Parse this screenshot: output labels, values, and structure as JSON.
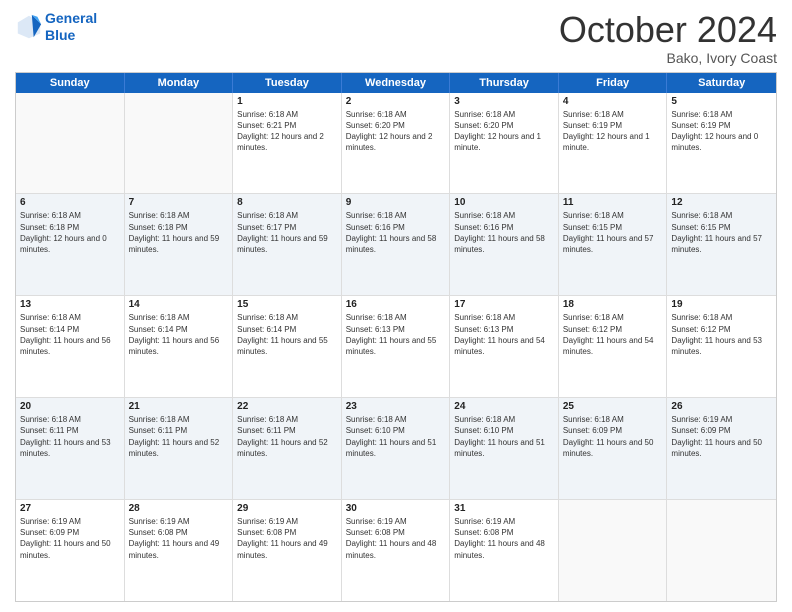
{
  "header": {
    "logo_line1": "General",
    "logo_line2": "Blue",
    "month": "October 2024",
    "location": "Bako, Ivory Coast"
  },
  "days_of_week": [
    "Sunday",
    "Monday",
    "Tuesday",
    "Wednesday",
    "Thursday",
    "Friday",
    "Saturday"
  ],
  "weeks": [
    [
      {
        "day": "",
        "sunrise": "",
        "sunset": "",
        "daylight": ""
      },
      {
        "day": "",
        "sunrise": "",
        "sunset": "",
        "daylight": ""
      },
      {
        "day": "1",
        "sunrise": "Sunrise: 6:18 AM",
        "sunset": "Sunset: 6:21 PM",
        "daylight": "Daylight: 12 hours and 2 minutes."
      },
      {
        "day": "2",
        "sunrise": "Sunrise: 6:18 AM",
        "sunset": "Sunset: 6:20 PM",
        "daylight": "Daylight: 12 hours and 2 minutes."
      },
      {
        "day": "3",
        "sunrise": "Sunrise: 6:18 AM",
        "sunset": "Sunset: 6:20 PM",
        "daylight": "Daylight: 12 hours and 1 minute."
      },
      {
        "day": "4",
        "sunrise": "Sunrise: 6:18 AM",
        "sunset": "Sunset: 6:19 PM",
        "daylight": "Daylight: 12 hours and 1 minute."
      },
      {
        "day": "5",
        "sunrise": "Sunrise: 6:18 AM",
        "sunset": "Sunset: 6:19 PM",
        "daylight": "Daylight: 12 hours and 0 minutes."
      }
    ],
    [
      {
        "day": "6",
        "sunrise": "Sunrise: 6:18 AM",
        "sunset": "Sunset: 6:18 PM",
        "daylight": "Daylight: 12 hours and 0 minutes."
      },
      {
        "day": "7",
        "sunrise": "Sunrise: 6:18 AM",
        "sunset": "Sunset: 6:18 PM",
        "daylight": "Daylight: 11 hours and 59 minutes."
      },
      {
        "day": "8",
        "sunrise": "Sunrise: 6:18 AM",
        "sunset": "Sunset: 6:17 PM",
        "daylight": "Daylight: 11 hours and 59 minutes."
      },
      {
        "day": "9",
        "sunrise": "Sunrise: 6:18 AM",
        "sunset": "Sunset: 6:16 PM",
        "daylight": "Daylight: 11 hours and 58 minutes."
      },
      {
        "day": "10",
        "sunrise": "Sunrise: 6:18 AM",
        "sunset": "Sunset: 6:16 PM",
        "daylight": "Daylight: 11 hours and 58 minutes."
      },
      {
        "day": "11",
        "sunrise": "Sunrise: 6:18 AM",
        "sunset": "Sunset: 6:15 PM",
        "daylight": "Daylight: 11 hours and 57 minutes."
      },
      {
        "day": "12",
        "sunrise": "Sunrise: 6:18 AM",
        "sunset": "Sunset: 6:15 PM",
        "daylight": "Daylight: 11 hours and 57 minutes."
      }
    ],
    [
      {
        "day": "13",
        "sunrise": "Sunrise: 6:18 AM",
        "sunset": "Sunset: 6:14 PM",
        "daylight": "Daylight: 11 hours and 56 minutes."
      },
      {
        "day": "14",
        "sunrise": "Sunrise: 6:18 AM",
        "sunset": "Sunset: 6:14 PM",
        "daylight": "Daylight: 11 hours and 56 minutes."
      },
      {
        "day": "15",
        "sunrise": "Sunrise: 6:18 AM",
        "sunset": "Sunset: 6:14 PM",
        "daylight": "Daylight: 11 hours and 55 minutes."
      },
      {
        "day": "16",
        "sunrise": "Sunrise: 6:18 AM",
        "sunset": "Sunset: 6:13 PM",
        "daylight": "Daylight: 11 hours and 55 minutes."
      },
      {
        "day": "17",
        "sunrise": "Sunrise: 6:18 AM",
        "sunset": "Sunset: 6:13 PM",
        "daylight": "Daylight: 11 hours and 54 minutes."
      },
      {
        "day": "18",
        "sunrise": "Sunrise: 6:18 AM",
        "sunset": "Sunset: 6:12 PM",
        "daylight": "Daylight: 11 hours and 54 minutes."
      },
      {
        "day": "19",
        "sunrise": "Sunrise: 6:18 AM",
        "sunset": "Sunset: 6:12 PM",
        "daylight": "Daylight: 11 hours and 53 minutes."
      }
    ],
    [
      {
        "day": "20",
        "sunrise": "Sunrise: 6:18 AM",
        "sunset": "Sunset: 6:11 PM",
        "daylight": "Daylight: 11 hours and 53 minutes."
      },
      {
        "day": "21",
        "sunrise": "Sunrise: 6:18 AM",
        "sunset": "Sunset: 6:11 PM",
        "daylight": "Daylight: 11 hours and 52 minutes."
      },
      {
        "day": "22",
        "sunrise": "Sunrise: 6:18 AM",
        "sunset": "Sunset: 6:11 PM",
        "daylight": "Daylight: 11 hours and 52 minutes."
      },
      {
        "day": "23",
        "sunrise": "Sunrise: 6:18 AM",
        "sunset": "Sunset: 6:10 PM",
        "daylight": "Daylight: 11 hours and 51 minutes."
      },
      {
        "day": "24",
        "sunrise": "Sunrise: 6:18 AM",
        "sunset": "Sunset: 6:10 PM",
        "daylight": "Daylight: 11 hours and 51 minutes."
      },
      {
        "day": "25",
        "sunrise": "Sunrise: 6:18 AM",
        "sunset": "Sunset: 6:09 PM",
        "daylight": "Daylight: 11 hours and 50 minutes."
      },
      {
        "day": "26",
        "sunrise": "Sunrise: 6:19 AM",
        "sunset": "Sunset: 6:09 PM",
        "daylight": "Daylight: 11 hours and 50 minutes."
      }
    ],
    [
      {
        "day": "27",
        "sunrise": "Sunrise: 6:19 AM",
        "sunset": "Sunset: 6:09 PM",
        "daylight": "Daylight: 11 hours and 50 minutes."
      },
      {
        "day": "28",
        "sunrise": "Sunrise: 6:19 AM",
        "sunset": "Sunset: 6:08 PM",
        "daylight": "Daylight: 11 hours and 49 minutes."
      },
      {
        "day": "29",
        "sunrise": "Sunrise: 6:19 AM",
        "sunset": "Sunset: 6:08 PM",
        "daylight": "Daylight: 11 hours and 49 minutes."
      },
      {
        "day": "30",
        "sunrise": "Sunrise: 6:19 AM",
        "sunset": "Sunset: 6:08 PM",
        "daylight": "Daylight: 11 hours and 48 minutes."
      },
      {
        "day": "31",
        "sunrise": "Sunrise: 6:19 AM",
        "sunset": "Sunset: 6:08 PM",
        "daylight": "Daylight: 11 hours and 48 minutes."
      },
      {
        "day": "",
        "sunrise": "",
        "sunset": "",
        "daylight": ""
      },
      {
        "day": "",
        "sunrise": "",
        "sunset": "",
        "daylight": ""
      }
    ]
  ]
}
